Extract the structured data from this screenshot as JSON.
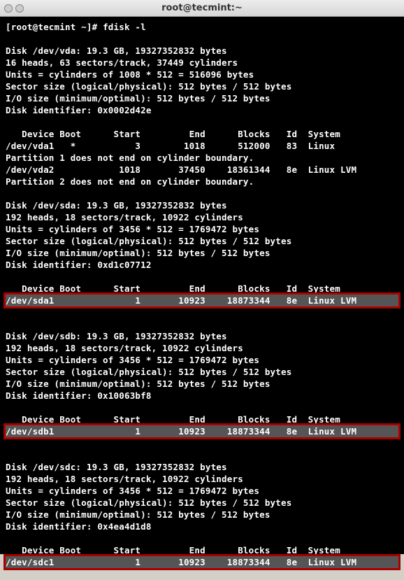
{
  "window": {
    "title": "root@tecmint:~"
  },
  "terminal": {
    "prompt": "[root@tecmint ~]# ",
    "command": "fdisk -l",
    "blank": "",
    "vda": {
      "disk_line": "Disk /dev/vda: 19.3 GB, 19327352832 bytes",
      "geometry": "16 heads, 63 sectors/track, 37449 cylinders",
      "units": "Units = cylinders of 1008 * 512 = 516096 bytes",
      "sector": "Sector size (logical/physical): 512 bytes / 512 bytes",
      "io": "I/O size (minimum/optimal): 512 bytes / 512 bytes",
      "ident": "Disk identifier: 0x0002d42e",
      "header": "   Device Boot      Start         End      Blocks   Id  System",
      "part1": "/dev/vda1   *           3        1018      512000   83  Linux",
      "warn1": "Partition 1 does not end on cylinder boundary.",
      "part2": "/dev/vda2            1018       37450    18361344   8e  Linux LVM",
      "warn2": "Partition 2 does not end on cylinder boundary."
    },
    "sda": {
      "disk_line": "Disk /dev/sda: 19.3 GB, 19327352832 bytes",
      "geometry": "192 heads, 18 sectors/track, 10922 cylinders",
      "units": "Units = cylinders of 3456 * 512 = 1769472 bytes",
      "sector": "Sector size (logical/physical): 512 bytes / 512 bytes",
      "io": "I/O size (minimum/optimal): 512 bytes / 512 bytes",
      "ident": "Disk identifier: 0xd1c07712",
      "header": "   Device Boot      Start         End      Blocks   Id  System",
      "part1": "/dev/sda1               1       10923    18873344   8e  Linux LVM"
    },
    "sdb": {
      "disk_line": "Disk /dev/sdb: 19.3 GB, 19327352832 bytes",
      "geometry": "192 heads, 18 sectors/track, 10922 cylinders",
      "units": "Units = cylinders of 3456 * 512 = 1769472 bytes",
      "sector": "Sector size (logical/physical): 512 bytes / 512 bytes",
      "io": "I/O size (minimum/optimal): 512 bytes / 512 bytes",
      "ident": "Disk identifier: 0x10063bf8",
      "header": "   Device Boot      Start         End      Blocks   Id  System",
      "part1": "/dev/sdb1               1       10923    18873344   8e  Linux LVM"
    },
    "sdc": {
      "disk_line": "Disk /dev/sdc: 19.3 GB, 19327352832 bytes",
      "geometry": "192 heads, 18 sectors/track, 10922 cylinders",
      "units": "Units = cylinders of 3456 * 512 = 1769472 bytes",
      "sector": "Sector size (logical/physical): 512 bytes / 512 bytes",
      "io": "I/O size (minimum/optimal): 512 bytes / 512 bytes",
      "ident": "Disk identifier: 0x4ea4d1d8",
      "header": "   Device Boot      Start         End      Blocks   Id  System",
      "part1": "/dev/sdc1               1       10923    18873344   8e  Linux LVM"
    }
  }
}
